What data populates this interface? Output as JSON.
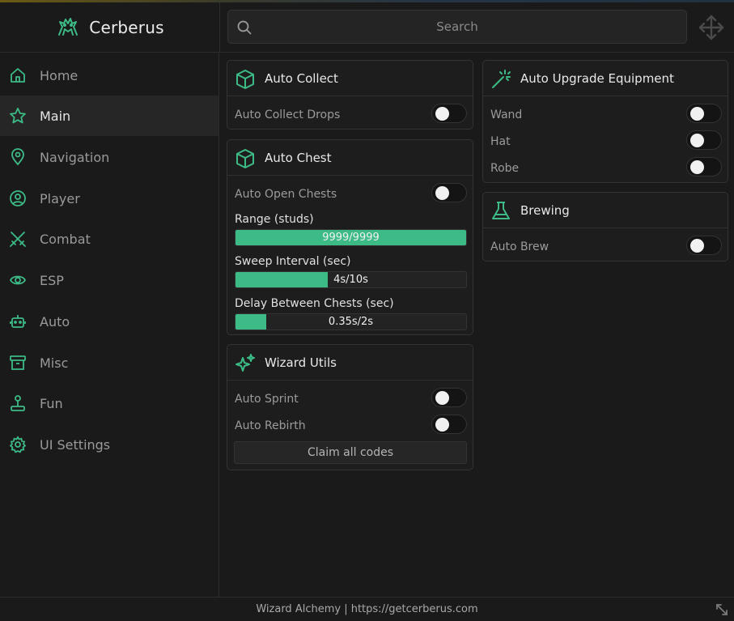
{
  "app": {
    "name": "Cerberus"
  },
  "search": {
    "placeholder": "Search"
  },
  "sidebar": {
    "items": [
      {
        "label": "Home",
        "icon": "home-icon"
      },
      {
        "label": "Main",
        "icon": "star-icon",
        "active": true
      },
      {
        "label": "Navigation",
        "icon": "map-pin-icon"
      },
      {
        "label": "Player",
        "icon": "user-circle-icon"
      },
      {
        "label": "Combat",
        "icon": "swords-icon"
      },
      {
        "label": "ESP",
        "icon": "eye-icon"
      },
      {
        "label": "Auto",
        "icon": "robot-icon"
      },
      {
        "label": "Misc",
        "icon": "archive-icon"
      },
      {
        "label": "Fun",
        "icon": "joystick-icon"
      },
      {
        "label": "UI Settings",
        "icon": "gear-icon"
      }
    ]
  },
  "panels": {
    "auto_collect": {
      "title": "Auto Collect",
      "icon": "cube-icon",
      "rows": [
        {
          "label": "Auto Collect Drops",
          "on": false
        }
      ]
    },
    "auto_chest": {
      "title": "Auto Chest",
      "icon": "cube-icon",
      "rows": [
        {
          "label": "Auto Open Chests",
          "on": false
        }
      ],
      "sliders": [
        {
          "label": "Range (studs)",
          "value_text": "9999/9999",
          "fraction": 1.0
        },
        {
          "label": "Sweep Interval (sec)",
          "value_text": "4s/10s",
          "fraction": 0.4
        },
        {
          "label": "Delay Between Chests (sec)",
          "value_text": "0.35s/2s",
          "fraction": 0.135
        }
      ]
    },
    "wizard_utils": {
      "title": "Wizard Utils",
      "icon": "sparkles-icon",
      "rows": [
        {
          "label": "Auto Sprint",
          "on": false
        },
        {
          "label": "Auto Rebirth",
          "on": false
        }
      ],
      "button": "Claim all codes"
    },
    "auto_upgrade": {
      "title": "Auto Upgrade Equipment",
      "icon": "magic-wand-icon",
      "rows": [
        {
          "label": "Wand",
          "on": false
        },
        {
          "label": "Hat",
          "on": false
        },
        {
          "label": "Robe",
          "on": false
        }
      ]
    },
    "brewing": {
      "title": "Brewing",
      "icon": "flask-icon",
      "rows": [
        {
          "label": "Auto Brew",
          "on": false
        }
      ]
    }
  },
  "footer": {
    "text": "Wizard Alchemy | https://getcerberus.com"
  },
  "colors": {
    "accent": "#3dbb87",
    "background": "#1a1a1a",
    "panel": "#1d1d1d"
  }
}
